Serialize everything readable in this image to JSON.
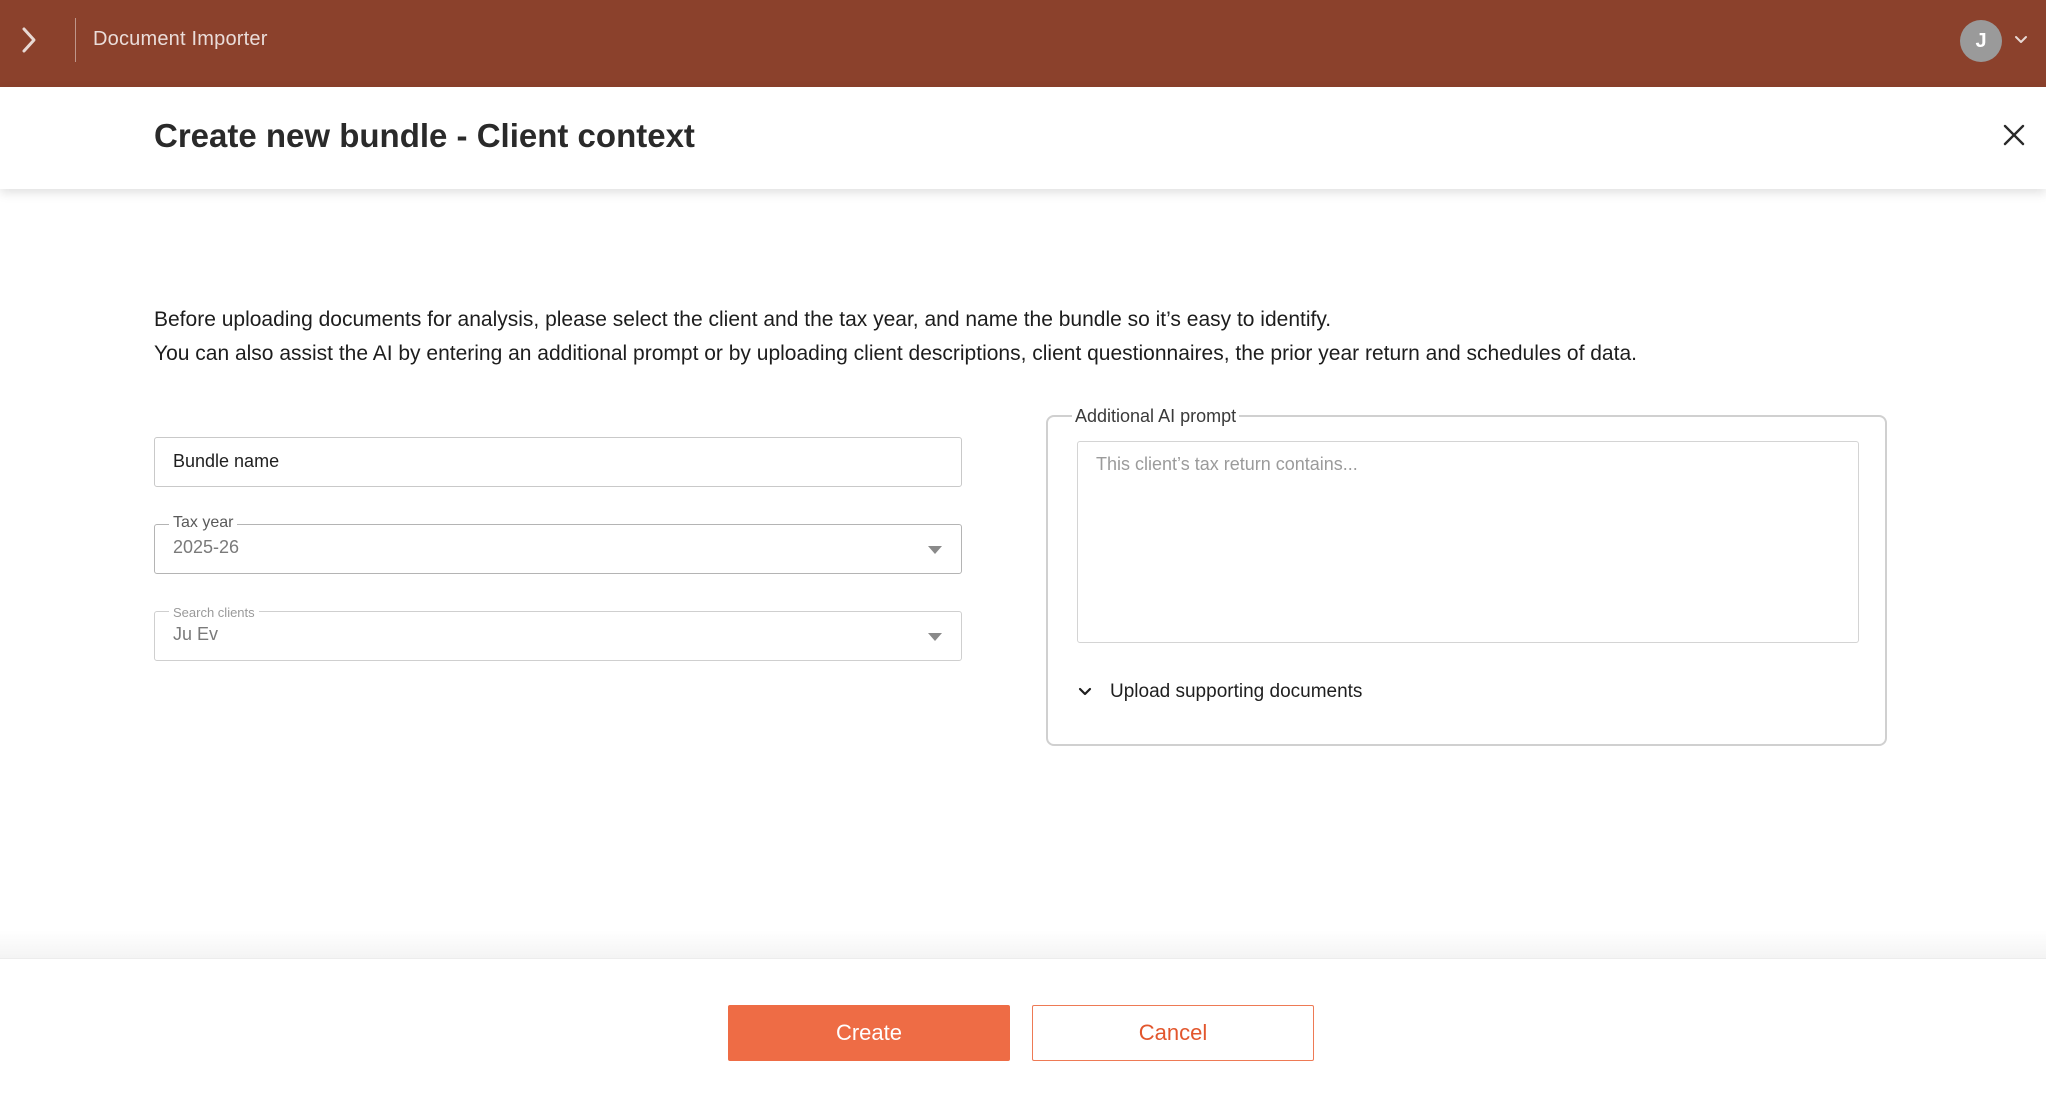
{
  "app": {
    "title": "Document Importer",
    "user_initial": "J"
  },
  "dialog": {
    "title": "Create new bundle - Client context"
  },
  "intro": {
    "line1": "Before uploading documents for analysis, please select the client and the tax year, and name the bundle so it’s easy to identify.",
    "line2": "You can also assist the AI by entering an additional prompt or by uploading client descriptions, client questionnaires, the prior year return and schedules of data."
  },
  "form": {
    "bundle_name": {
      "placeholder": "Bundle name",
      "value": ""
    },
    "tax_year": {
      "label": "Tax year",
      "value": "2025-26"
    },
    "search_clients": {
      "label": "Search clients",
      "value": "Ju Ev"
    }
  },
  "ai_prompt": {
    "legend": "Additional AI prompt",
    "placeholder": "This client’s tax return contains..."
  },
  "upload": {
    "label": "Upload supporting documents"
  },
  "actions": {
    "create_label": "Create",
    "cancel_label": "Cancel"
  },
  "colors": {
    "topbar": "#8b412c",
    "primary": "#ee6c45",
    "cancel_text": "#e2562d"
  }
}
